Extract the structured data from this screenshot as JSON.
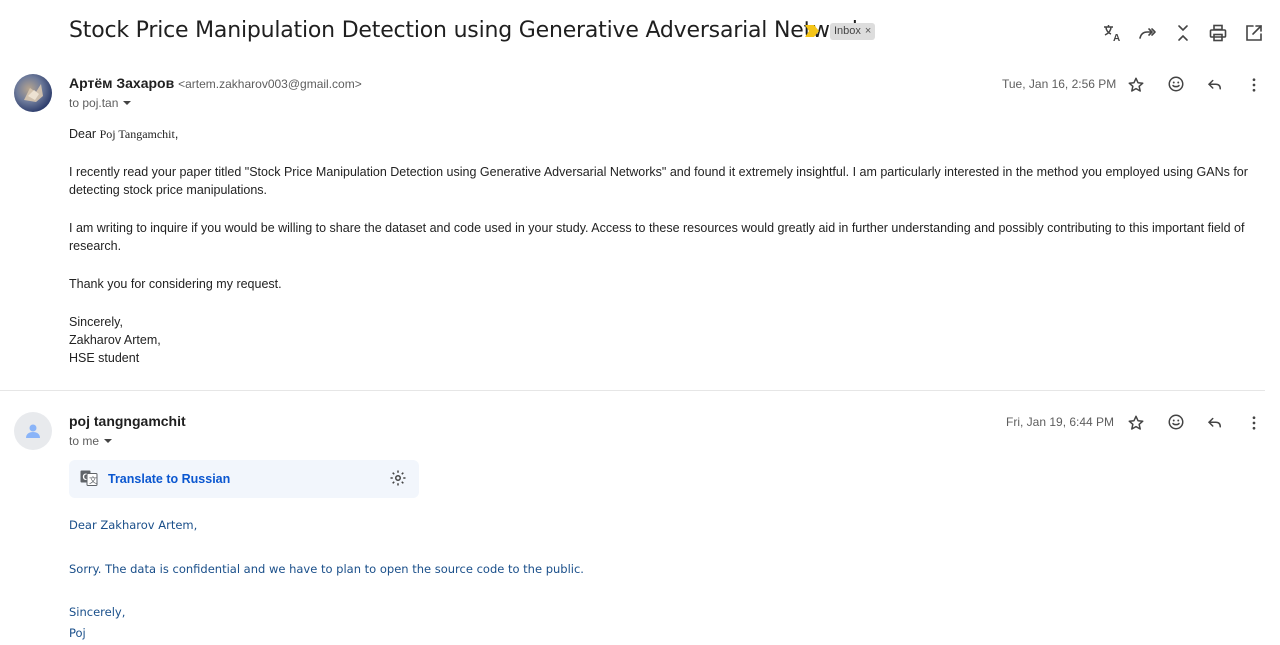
{
  "subject": "Stock Price Manipulation Detection using Generative Adversarial Networks",
  "label": "Inbox",
  "label_close": "×",
  "toolbar_icons": [
    "translate-icon",
    "forward-all-icon",
    "collapse-icon",
    "print-icon",
    "open-new-window-icon"
  ],
  "messages": [
    {
      "sender_name": "Артём Захаров",
      "sender_email": "<artem.zakharov003@gmail.com>",
      "to": "to poj.tan",
      "date": "Tue, Jan 16, 2:56 PM",
      "greeting_prefix": "Dear ",
      "greeting_name": "Poj Tangamchit",
      "greeting_suffix": ",",
      "paragraphs": [
        "I recently read your paper titled \"Stock Price Manipulation Detection using Generative Adversarial Networks\" and found it extremely insightful. I am particularly interested in the method you employed using GANs for detecting stock price manipulations.",
        "I am writing to inquire if you would be willing to share the dataset and code used in your study. Access to these resources would greatly aid in further understanding and possibly contributing to this important field of research.",
        "Thank you for considering my request."
      ],
      "signoff": "Sincerely,",
      "signature_name": "Zakharov Artem,",
      "signature_title": "HSE student"
    },
    {
      "sender_name": "poj tangngamchit",
      "to": "to me",
      "date": "Fri, Jan 19, 6:44 PM",
      "translate_label": "Translate to Russian",
      "greeting": "Dear Zakharov Artem,",
      "body": "Sorry. The data is confidential and we have to plan to open the source code to the public.",
      "signoff": "Sincerely,",
      "signature": "Poj"
    }
  ],
  "colors": {
    "link_blue": "#0b57d0",
    "reply_text": "#1a4f8a",
    "important_marker": "#f5c518",
    "label_bg": "#dddddd"
  }
}
